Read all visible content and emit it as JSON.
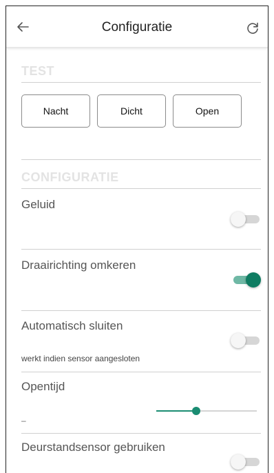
{
  "appbar": {
    "title": "Configuratie",
    "back_icon": "arrow-left-icon",
    "refresh_icon": "refresh-icon"
  },
  "test": {
    "title": "TEST",
    "buttons": [
      "Nacht",
      "Dicht",
      "Open"
    ]
  },
  "config": {
    "title": "CONFIGURATIE",
    "items": [
      {
        "label": "Geluid",
        "on": false
      },
      {
        "label": "Draairichting omkeren",
        "on": true
      },
      {
        "label": "Automatisch sluiten",
        "sublabel": "werkt indien sensor aangesloten",
        "on": false
      },
      {
        "label": "Opentijd",
        "value_text": "–",
        "slider_value": 0.4
      },
      {
        "label": "Deurstandsensor gebruiken",
        "on": false
      }
    ]
  },
  "colors": {
    "accent": "#0f7c62",
    "accent_track": "#6fb8a5",
    "section_title": "#e3e3e3"
  }
}
